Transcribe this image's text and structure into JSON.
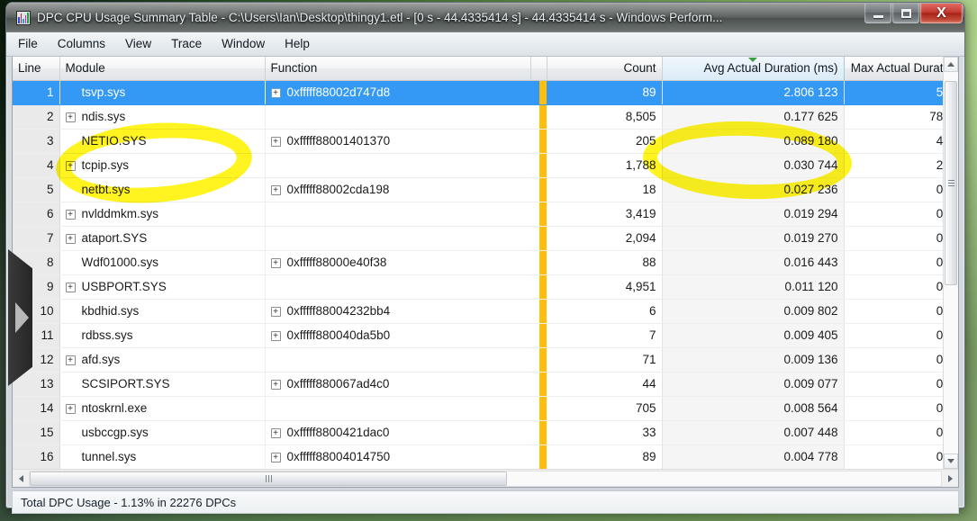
{
  "window": {
    "title": "DPC CPU Usage Summary Table - C:\\Users\\Ian\\Desktop\\thingy1.etl - [0 s - 44.4335414 s] - 44.4335414 s - Windows Perform...",
    "icon": "bar-chart-icon",
    "minimize_label": "Minimize",
    "maximize_label": "Maximize",
    "close_label": "X"
  },
  "menubar": {
    "items": [
      {
        "label": "File"
      },
      {
        "label": "Columns"
      },
      {
        "label": "View"
      },
      {
        "label": "Trace"
      },
      {
        "label": "Window"
      },
      {
        "label": "Help"
      }
    ]
  },
  "grid": {
    "columns": [
      {
        "key": "line",
        "label": "Line",
        "align": "right"
      },
      {
        "key": "module",
        "label": "Module",
        "align": "left"
      },
      {
        "key": "func",
        "label": "Function",
        "align": "left"
      },
      {
        "key": "swatch",
        "label": "",
        "align": "left"
      },
      {
        "key": "count",
        "label": "Count",
        "align": "right"
      },
      {
        "key": "avg",
        "label": "Avg Actual Duration (ms)",
        "align": "right",
        "sorted": true,
        "sort_dir": "descending"
      },
      {
        "key": "max",
        "label": "Max Actual Durati",
        "align": "right"
      }
    ],
    "sort_column": "Avg Actual Duration (ms)",
    "swatch_color": "#ffbe0b",
    "selection_color": "#3399f4",
    "count_color": "#2a7d2a",
    "avg_color": "#3b2fd0",
    "rows": [
      {
        "line": "1",
        "module": "tsvp.sys",
        "module_expandable": false,
        "func": "0xfffff88002d747d8",
        "func_expandable": true,
        "count": "89",
        "avg": "2.806 123",
        "max": "5.",
        "selected": true
      },
      {
        "line": "2",
        "module": "ndis.sys",
        "module_expandable": true,
        "func": "",
        "func_expandable": false,
        "count": "8,505",
        "avg": "0.177 625",
        "max": "78.",
        "selected": false
      },
      {
        "line": "3",
        "module": "NETIO.SYS",
        "module_expandable": false,
        "func": "0xfffff88001401370",
        "func_expandable": true,
        "count": "205",
        "avg": "0.089 180",
        "max": "4.",
        "selected": false
      },
      {
        "line": "4",
        "module": "tcpip.sys",
        "module_expandable": true,
        "func": "",
        "func_expandable": false,
        "count": "1,788",
        "avg": "0.030 744",
        "max": "2.",
        "selected": false
      },
      {
        "line": "5",
        "module": "netbt.sys",
        "module_expandable": false,
        "func": "0xfffff88002cda198",
        "func_expandable": true,
        "count": "18",
        "avg": "0.027 236",
        "max": "0.",
        "selected": false
      },
      {
        "line": "6",
        "module": "nvlddmkm.sys",
        "module_expandable": true,
        "func": "",
        "func_expandable": false,
        "count": "3,419",
        "avg": "0.019 294",
        "max": "0.",
        "selected": false
      },
      {
        "line": "7",
        "module": "ataport.SYS",
        "module_expandable": true,
        "func": "",
        "func_expandable": false,
        "count": "2,094",
        "avg": "0.019 270",
        "max": "0.",
        "selected": false
      },
      {
        "line": "8",
        "module": "Wdf01000.sys",
        "module_expandable": false,
        "func": "0xfffff88000e40f38",
        "func_expandable": true,
        "count": "88",
        "avg": "0.016 443",
        "max": "0.",
        "selected": false
      },
      {
        "line": "9",
        "module": "USBPORT.SYS",
        "module_expandable": true,
        "func": "",
        "func_expandable": false,
        "count": "4,951",
        "avg": "0.011 120",
        "max": "0.",
        "selected": false
      },
      {
        "line": "10",
        "module": "kbdhid.sys",
        "module_expandable": false,
        "func": "0xfffff88004232bb4",
        "func_expandable": true,
        "count": "6",
        "avg": "0.009 802",
        "max": "0.",
        "selected": false
      },
      {
        "line": "11",
        "module": "rdbss.sys",
        "module_expandable": false,
        "func": "0xfffff880040da5b0",
        "func_expandable": true,
        "count": "7",
        "avg": "0.009 405",
        "max": "0.",
        "selected": false
      },
      {
        "line": "12",
        "module": "afd.sys",
        "module_expandable": true,
        "func": "",
        "func_expandable": false,
        "count": "71",
        "avg": "0.009 136",
        "max": "0.",
        "selected": false
      },
      {
        "line": "13",
        "module": "SCSIPORT.SYS",
        "module_expandable": false,
        "func": "0xfffff880067ad4c0",
        "func_expandable": true,
        "count": "44",
        "avg": "0.009 077",
        "max": "0.",
        "selected": false
      },
      {
        "line": "14",
        "module": "ntoskrnl.exe",
        "module_expandable": true,
        "func": "",
        "func_expandable": false,
        "count": "705",
        "avg": "0.008 564",
        "max": "0.",
        "selected": false
      },
      {
        "line": "15",
        "module": "usbccgp.sys",
        "module_expandable": false,
        "func": "0xfffff8800421dac0",
        "func_expandable": true,
        "count": "33",
        "avg": "0.007 448",
        "max": "0.",
        "selected": false
      },
      {
        "line": "16",
        "module": "tunnel.sys",
        "module_expandable": false,
        "func": "0xfffff88004014750",
        "func_expandable": true,
        "count": "89",
        "avg": "0.004 778",
        "max": "0.",
        "selected": false
      }
    ]
  },
  "statusbar": {
    "text": "Total DPC Usage - 1.13% in 22276 DPCs"
  },
  "annotations": {
    "highlighter_color": "#fff200",
    "circled_items": [
      "Module",
      "Avg Actual Duration (ms)"
    ]
  },
  "flyout": {
    "arrow_icon": "triangle-right-icon"
  }
}
